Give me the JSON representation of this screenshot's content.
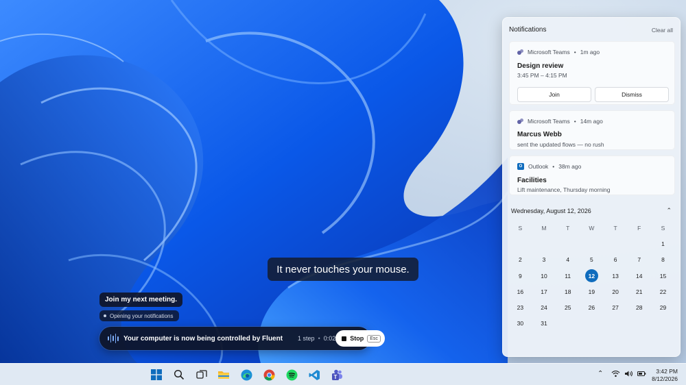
{
  "caption": "It never touches your mouse.",
  "agent": {
    "prompt": "Join my next meeting.",
    "status": "Opening your notifications",
    "bar_text": "Your computer is now being controlled by Fluent",
    "step": "1 step",
    "separator": "•",
    "elapsed": "0:02",
    "stop_label": "Stop",
    "esc_label": "Esc"
  },
  "notifications": {
    "title": "Notifications",
    "clear_all": "Clear all",
    "items": [
      {
        "app": "Microsoft Teams",
        "dot": "•",
        "time": "1m ago",
        "title": "Design review",
        "subtitle": "3:45 PM – 4:15 PM",
        "icon": "teams-icon",
        "actions": [
          "Join",
          "Dismiss"
        ]
      },
      {
        "app": "Microsoft Teams",
        "dot": "•",
        "time": "14m ago",
        "title": "Marcus Webb",
        "subtitle": "sent the updated flows — no rush",
        "icon": "teams-icon"
      },
      {
        "app": "Outlook",
        "dot": "•",
        "time": "38m ago",
        "title": "Facilities",
        "subtitle": "Lift maintenance, Thursday morning",
        "icon": "outlook-icon"
      }
    ]
  },
  "calendar": {
    "date_heading": "Wednesday, August 12, 2026",
    "days_of_week": [
      "S",
      "M",
      "T",
      "W",
      "T",
      "F",
      "S"
    ],
    "weeks": [
      [
        "",
        "",
        "",
        "",
        "",
        "",
        "1"
      ],
      [
        "2",
        "3",
        "4",
        "5",
        "6",
        "7",
        "8"
      ],
      [
        "9",
        "10",
        "11",
        "12",
        "13",
        "14",
        "15"
      ],
      [
        "16",
        "17",
        "18",
        "19",
        "20",
        "21",
        "22"
      ],
      [
        "23",
        "24",
        "25",
        "26",
        "27",
        "28",
        "29"
      ],
      [
        "30",
        "31",
        "",
        "",
        "",
        "",
        ""
      ]
    ],
    "today": "12",
    "accent": "#0f6cbd"
  },
  "taskbar": {
    "apps": [
      "start-icon",
      "search-icon",
      "task-view-icon",
      "file-explorer-icon",
      "edge-icon",
      "chrome-icon",
      "spotify-icon",
      "vscode-icon",
      "teams-icon"
    ],
    "tray": [
      "chevron-up-icon",
      "wifi-icon",
      "volume-icon",
      "battery-icon"
    ],
    "time": "3:42 PM",
    "date": "8/12/2026"
  }
}
